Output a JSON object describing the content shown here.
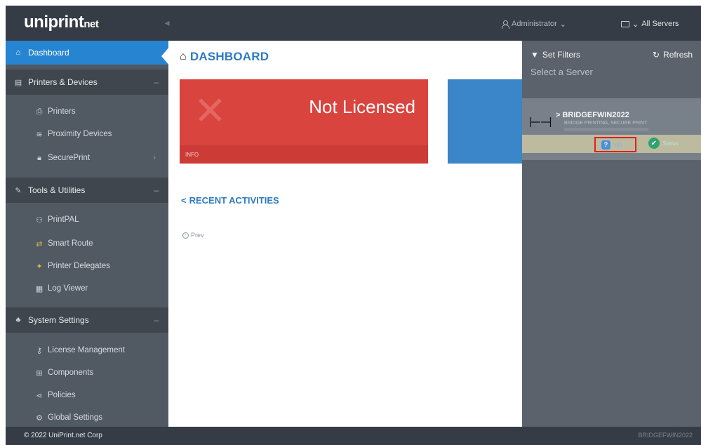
{
  "app": {
    "logo_main": "uniprint",
    "logo_suffix": "net",
    "collapse_glyph": "◂"
  },
  "header": {
    "admin_label": "Administrator",
    "admin_caret": "⌄",
    "servers_label": "All Servers",
    "servers_icon": "monitor-icon",
    "servers_caret": "⌄"
  },
  "sidebar": {
    "dashboard": "Dashboard",
    "printers_devices": "Printers & Devices",
    "printers": "Printers",
    "proximity_devices": "Proximity Devices",
    "secureprint": "SecurePrint",
    "tools_utilities": "Tools & Utilities",
    "printpal": "PrintPAL",
    "smart_route": "Smart Route",
    "printer_delegates": "Printer Delegates",
    "log_viewer": "Log Viewer",
    "system_settings": "System Settings",
    "license_management": "License Management",
    "components": "Components",
    "policies": "Policies",
    "global_settings": "Global Settings"
  },
  "main": {
    "title": "DASHBOARD",
    "license_tile": {
      "text": "Not Licensed",
      "footer": "INFO",
      "color": "#d9443f"
    },
    "recent_title": "RECENT ACTIVITIES",
    "prev_label": "Prev"
  },
  "right_panel": {
    "filters_label": "Set Filters",
    "refresh_label": "Refresh",
    "select_label": "Select a Server",
    "server": {
      "name": "BRIDGEFWIN2022",
      "description": "BRIDGE PRINTING, SECURE PRINT",
      "info_label": "Info",
      "status_label": "Status"
    }
  },
  "footer": {
    "copyright": "© 2022 UniPrint.net Corp",
    "server_name": "BRIDGEFWIN2022"
  },
  "colors": {
    "accent": "#2784d0",
    "sidebar_bg": "#515962",
    "header_bg": "#353c45",
    "highlight": "#e01f1f"
  }
}
